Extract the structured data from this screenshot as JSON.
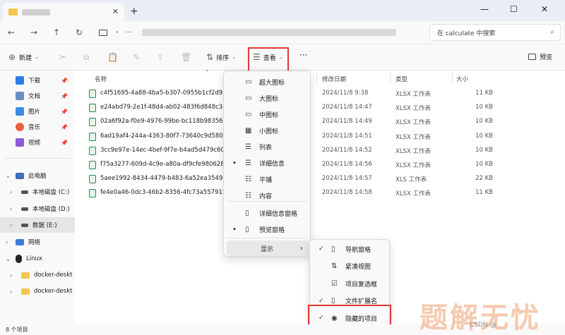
{
  "window": {
    "minimize": "—",
    "maximize": "☐",
    "close": "✕"
  },
  "tab": {
    "close": "✕",
    "new_tab": "+"
  },
  "nav": {
    "back": "←",
    "forward": "→",
    "up": "↑",
    "refresh": "↻",
    "more": "···"
  },
  "search": {
    "placeholder": "在 calculate 中搜索"
  },
  "toolbar": {
    "new_label": "新建",
    "sort_label": "排序",
    "view_label": "查看",
    "more": "···",
    "preview_label": "预览"
  },
  "sidebar": {
    "quick": [
      {
        "label": "下载",
        "color": "#2b7de9"
      },
      {
        "label": "文档",
        "color": "#6a8fc4"
      },
      {
        "label": "图片",
        "color": "#3a8de0"
      },
      {
        "label": "音乐",
        "color": "#e8603c"
      },
      {
        "label": "视频",
        "color": "#8a5cd6"
      }
    ],
    "this_pc": "此电脑",
    "drives": [
      {
        "label": "本地磁盘 (C:)"
      },
      {
        "label": "本地磁盘 (D:)"
      },
      {
        "label": "数据 (E:)"
      }
    ],
    "network": "网络",
    "linux": "Linux",
    "docker": [
      {
        "label": "docker-deskt"
      },
      {
        "label": "docker-deskt"
      }
    ]
  },
  "columns": {
    "name": "名称",
    "modified": "修改日期",
    "type": "类型",
    "size": "大小"
  },
  "files": [
    {
      "name": "c4f51695-4a88-4ba5-b307-0955b1cf2d95_",
      "date": "2024/11/8 9:38",
      "type": "XLSX 工作表",
      "size": "11 KB"
    },
    {
      "name": "e24abd79-2e1f-48d4-ab02-483f6d848c34_",
      "date": "2024/11/8 14:47",
      "type": "XLSX 工作表",
      "size": "10 KB"
    },
    {
      "name": "02a6f92a-f0e9-4976-99be-bc118b98356e_",
      "date": "2024/11/8 14:49",
      "type": "XLSX 工作表",
      "size": "10 KB"
    },
    {
      "name": "6ad19af4-244a-4363-80f7-73640c9d580c_",
      "date": "2024/11/8 14:51",
      "type": "XLSX 工作表",
      "size": "10 KB"
    },
    {
      "name": "3cc9e97e-14ec-4bef-9f7e-b4ad5d479c60_",
      "date": "2024/11/8 14:52",
      "type": "XLSX 工作表",
      "size": "10 KB"
    },
    {
      "name": "f75a3277-609d-4c9e-a80a-df9cfe980628_",
      "date": "2024/11/8 14:56",
      "type": "XLSX 工作表",
      "size": "10 KB"
    },
    {
      "name": "5aee1992-8434-4479-b483-6a52ea354911_",
      "date": "2024/11/8 14:57",
      "type": "XLS 工作表",
      "size": "22 KB"
    },
    {
      "name": "fe4e0a46-0dc3-46b2-8356-4fc73a557915_",
      "date": "2024/11/8 14:58",
      "type": "XLSX 工作表",
      "size": "11 KB"
    }
  ],
  "view_menu": {
    "items": [
      {
        "label": "超大图标",
        "icon": "▭",
        "dot": ""
      },
      {
        "label": "大图标",
        "icon": "▭",
        "dot": ""
      },
      {
        "label": "中图标",
        "icon": "▭",
        "dot": ""
      },
      {
        "label": "小图标",
        "icon": "▦",
        "dot": ""
      },
      {
        "label": "列表",
        "icon": "☰",
        "dot": ""
      },
      {
        "label": "详细信息",
        "icon": "☰",
        "dot": "•"
      },
      {
        "label": "平铺",
        "icon": "☷",
        "dot": ""
      },
      {
        "label": "内容",
        "icon": "☷",
        "dot": ""
      }
    ],
    "panes": [
      {
        "label": "详细信息窗格",
        "icon": "▯",
        "dot": ""
      },
      {
        "label": "预览窗格",
        "icon": "▯",
        "dot": "•"
      }
    ],
    "show_label": "显示",
    "show_arrow": "›"
  },
  "show_menu": {
    "items": [
      {
        "label": "导航窗格",
        "icon": "▯",
        "check": "✓"
      },
      {
        "label": "紧凑视图",
        "icon": "⇅",
        "check": ""
      },
      {
        "label": "项目复选框",
        "icon": "☑",
        "check": ""
      },
      {
        "label": "文件扩展名",
        "icon": "▯",
        "check": "✓"
      },
      {
        "label": "隐藏的项目",
        "icon": "◉",
        "check": "✓"
      }
    ]
  },
  "status": {
    "count": "8 个项目"
  },
  "watermark": {
    "text": "题解无忧",
    "csdn": "CSDN @"
  }
}
